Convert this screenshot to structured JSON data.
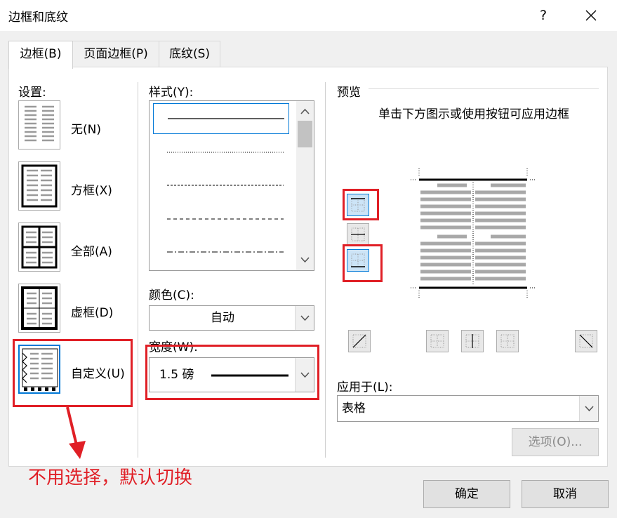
{
  "window": {
    "title": "边框和底纹",
    "help_label": "?"
  },
  "tabs": [
    {
      "label": "边框(B)",
      "active": true
    },
    {
      "label": "页面边框(P)",
      "active": false
    },
    {
      "label": "底纹(S)",
      "active": false
    }
  ],
  "settings": {
    "heading": "设置:",
    "items": [
      {
        "label": "无(N)",
        "icon": "border-none-icon"
      },
      {
        "label": "方框(X)",
        "icon": "border-box-icon"
      },
      {
        "label": "全部(A)",
        "icon": "border-all-icon"
      },
      {
        "label": "虚框(D)",
        "icon": "border-grid-icon"
      },
      {
        "label": "自定义(U)",
        "icon": "border-custom-icon",
        "selected": true
      }
    ]
  },
  "style": {
    "heading": "样式(Y):",
    "line_styles": [
      "solid",
      "dotted",
      "dense-dashed",
      "dashed",
      "dash-dot"
    ],
    "selected_index": 0
  },
  "color": {
    "heading": "颜色(C):",
    "value": "自动"
  },
  "width": {
    "heading": "宽度(W):",
    "value": "1.5 磅"
  },
  "preview": {
    "heading": "预览",
    "hint": "单击下方图示或使用按钮可应用边框"
  },
  "apply_to": {
    "heading": "应用于(L):",
    "value": "表格"
  },
  "buttons": {
    "options": "选项(O)...",
    "ok": "确定",
    "cancel": "取消"
  },
  "annotation": {
    "text": "不用选择，默认切换"
  },
  "colors": {
    "highlight_red": "#e01f26",
    "selection_blue": "#0078d7",
    "toggle_blue": "#cce4f7"
  }
}
